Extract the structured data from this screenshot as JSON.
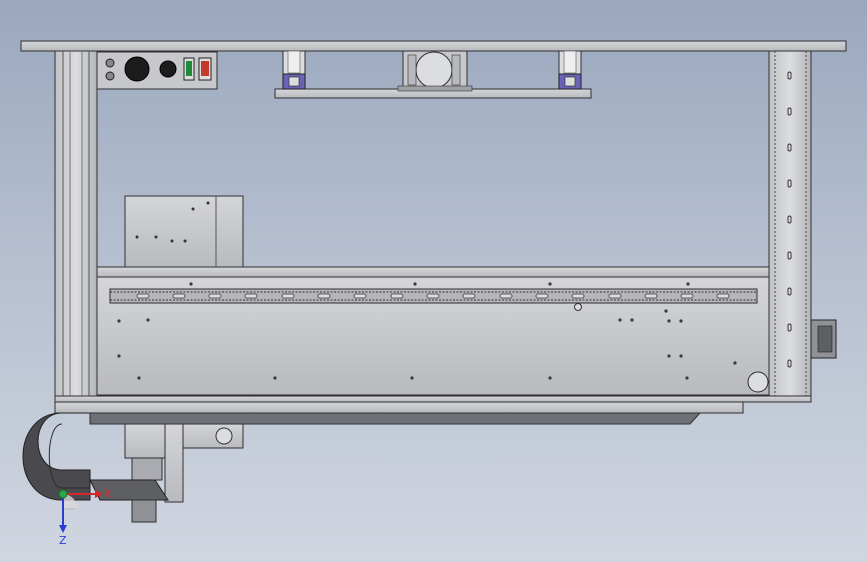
{
  "viewport": {
    "background_top": "#9aa7bd",
    "background_bottom": "#d0d6e0"
  },
  "model": {
    "metal_color": "#c9cacd",
    "metal_dark": "#a9abb0",
    "outline_color": "#2f2f33",
    "chain_color": "#4a4a4e",
    "control_panel": {
      "green_switch": "#1f8a3a",
      "red_switch": "#c23a2a",
      "knob_color": "#1c1c1c"
    },
    "cylinder_accent": "#5a4fa8"
  },
  "triad": {
    "x_label": "X",
    "z_label": "Z",
    "x_color": "#d22a2a",
    "y_color": "#2aa84a",
    "z_color": "#2a3fd2"
  }
}
